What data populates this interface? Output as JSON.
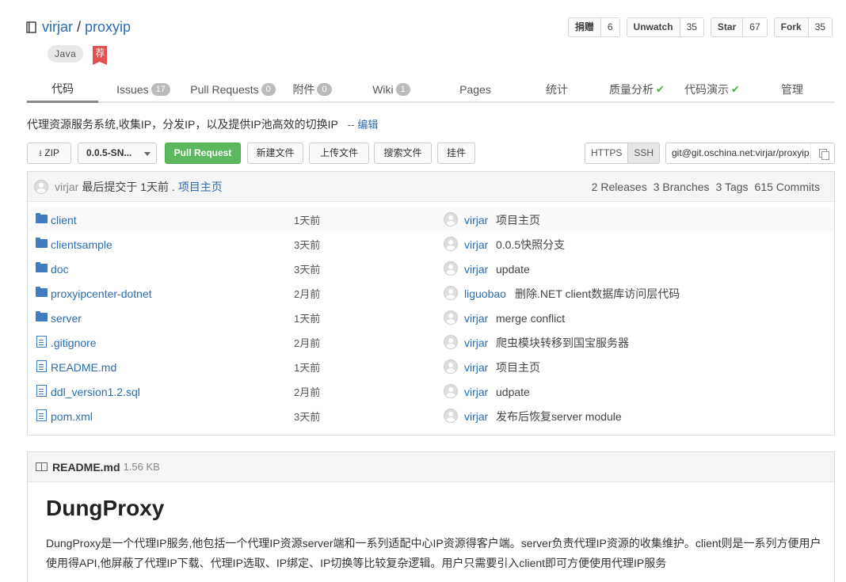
{
  "repo": {
    "owner": "virjar",
    "name": "proxyip",
    "language": "Java",
    "badge": "荐"
  },
  "social": [
    {
      "label": "捐赠",
      "count": "6"
    },
    {
      "label": "Unwatch",
      "count": "35"
    },
    {
      "label": "Star",
      "count": "67"
    },
    {
      "label": "Fork",
      "count": "35"
    }
  ],
  "tabs": [
    {
      "label": "代码",
      "count": null
    },
    {
      "label": "Issues",
      "count": "17"
    },
    {
      "label": "Pull Requests",
      "count": "0"
    },
    {
      "label": "附件",
      "count": "0"
    },
    {
      "label": "Wiki",
      "count": "1"
    },
    {
      "label": "Pages",
      "count": null
    },
    {
      "label": "统计",
      "count": null
    },
    {
      "label": "质量分析",
      "count": null
    },
    {
      "label": "代码演示",
      "count": null
    },
    {
      "label": "管理",
      "count": null
    }
  ],
  "description": {
    "text": "代理资源服务系统,收集IP，分发IP，以及提供IP池高效的切换IP",
    "dash": "--",
    "edit": "编辑"
  },
  "toolbar": {
    "zip": "ZIP",
    "branch": "0.0.5-SN...",
    "pull_request": "Pull Request",
    "new_file": "新建文件",
    "upload": "上传文件",
    "search": "搜索文件",
    "widget": "挂件",
    "https": "HTTPS",
    "ssh": "SSH",
    "clone_url": "git@git.oschina.net:virjar/proxyip.git"
  },
  "last_commit": {
    "author": "virjar",
    "text": "最后提交于 1天前 .",
    "link": "项目主页",
    "releases": "2 Releases",
    "branches": "3 Branches",
    "tags": "3 Tags",
    "commits": "615 Commits"
  },
  "files": [
    {
      "type": "folder",
      "name": "client",
      "time": "1天前",
      "author": "virjar",
      "message": "项目主页"
    },
    {
      "type": "folder",
      "name": "clientsample",
      "time": "3天前",
      "author": "virjar",
      "message": "0.0.5快照分支"
    },
    {
      "type": "folder",
      "name": "doc",
      "time": "3天前",
      "author": "virjar",
      "message": "update"
    },
    {
      "type": "folder",
      "name": "proxyipcenter-dotnet",
      "time": "2月前",
      "author": "liguobao",
      "message": "删除.NET client数据库访问层代码"
    },
    {
      "type": "folder",
      "name": "server",
      "time": "1天前",
      "author": "virjar",
      "message": "merge conflict"
    },
    {
      "type": "file",
      "name": ".gitignore",
      "time": "2月前",
      "author": "virjar",
      "message": "爬虫模块转移到国宝服务器"
    },
    {
      "type": "file",
      "name": "README.md",
      "time": "1天前",
      "author": "virjar",
      "message": "项目主页"
    },
    {
      "type": "file",
      "name": "ddl_version1.2.sql",
      "time": "2月前",
      "author": "virjar",
      "message": "udpate"
    },
    {
      "type": "file",
      "name": "pom.xml",
      "time": "3天前",
      "author": "virjar",
      "message": "发布后恢复server module"
    }
  ],
  "readme": {
    "filename": "README.md",
    "size": "1.56 KB",
    "heading": "DungProxy",
    "body": "DungProxy是一个代理IP服务,他包括一个代理IP资源server端和一系列适配中心IP资源得客户端。server负责代理IP资源的收集维护。client则是一系列方便用户使用得API,他屏蔽了代理IP下载、代理IP选取、IP绑定、IP切换等比较复杂逻辑。用户只需要引入client即可方便使用代理IP服务"
  }
}
